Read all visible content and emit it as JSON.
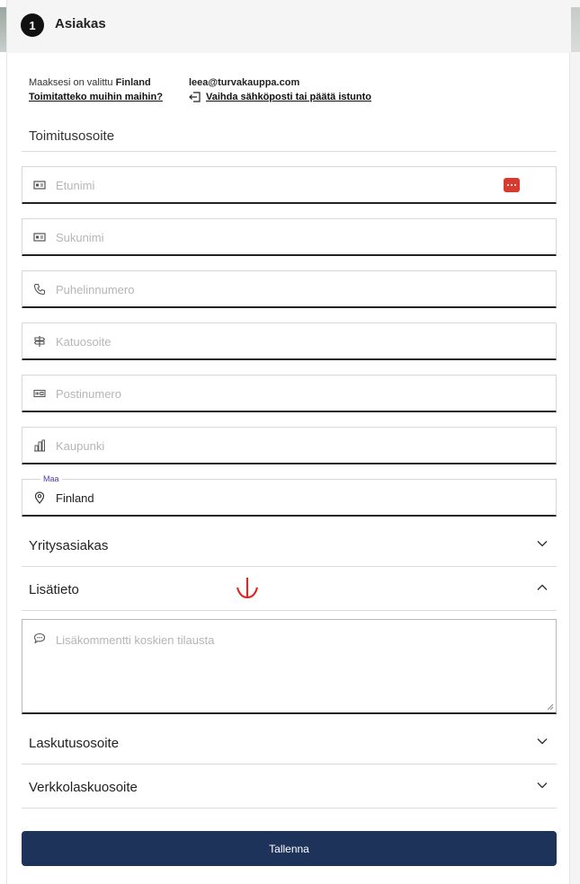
{
  "header": {
    "step": "1",
    "title": "Asiakas"
  },
  "info": {
    "country_prefix": "Maaksesi on valittu",
    "country": "Finland",
    "other_country_link": "Toimitatteko muihin maihin?",
    "email": "leea@turvakauppa.com",
    "change_link": "Vaihda sähköposti tai päätä istunto"
  },
  "shipping": {
    "title": "Toimitusosoite",
    "fields": [
      {
        "placeholder": "Etunimi",
        "icon": "id-card-icon"
      },
      {
        "placeholder": "Sukunimi",
        "icon": "id-card-icon"
      },
      {
        "placeholder": "Puhelinnumero",
        "icon": "phone-icon"
      },
      {
        "placeholder": "Katuosoite",
        "icon": "signpost-icon"
      },
      {
        "placeholder": "Postinumero",
        "icon": "postcode-icon"
      },
      {
        "placeholder": "Kaupunki",
        "icon": "city-icon"
      }
    ],
    "country_field": {
      "label": "Maa",
      "value": "Finland",
      "icon": "map-pin-icon"
    }
  },
  "sections": {
    "company": "Yritysasiakas",
    "extra": "Lisätieto",
    "billing": "Laskutusosoite",
    "einvoice": "Verkkolaskuosoite"
  },
  "comment": {
    "placeholder": "Lisäkommentti koskien tilausta"
  },
  "save_label": "Tallenna",
  "colors": {
    "primary": "#1e3359",
    "label_accent": "#4b3aa8",
    "annotation_red": "#d62b2b"
  }
}
